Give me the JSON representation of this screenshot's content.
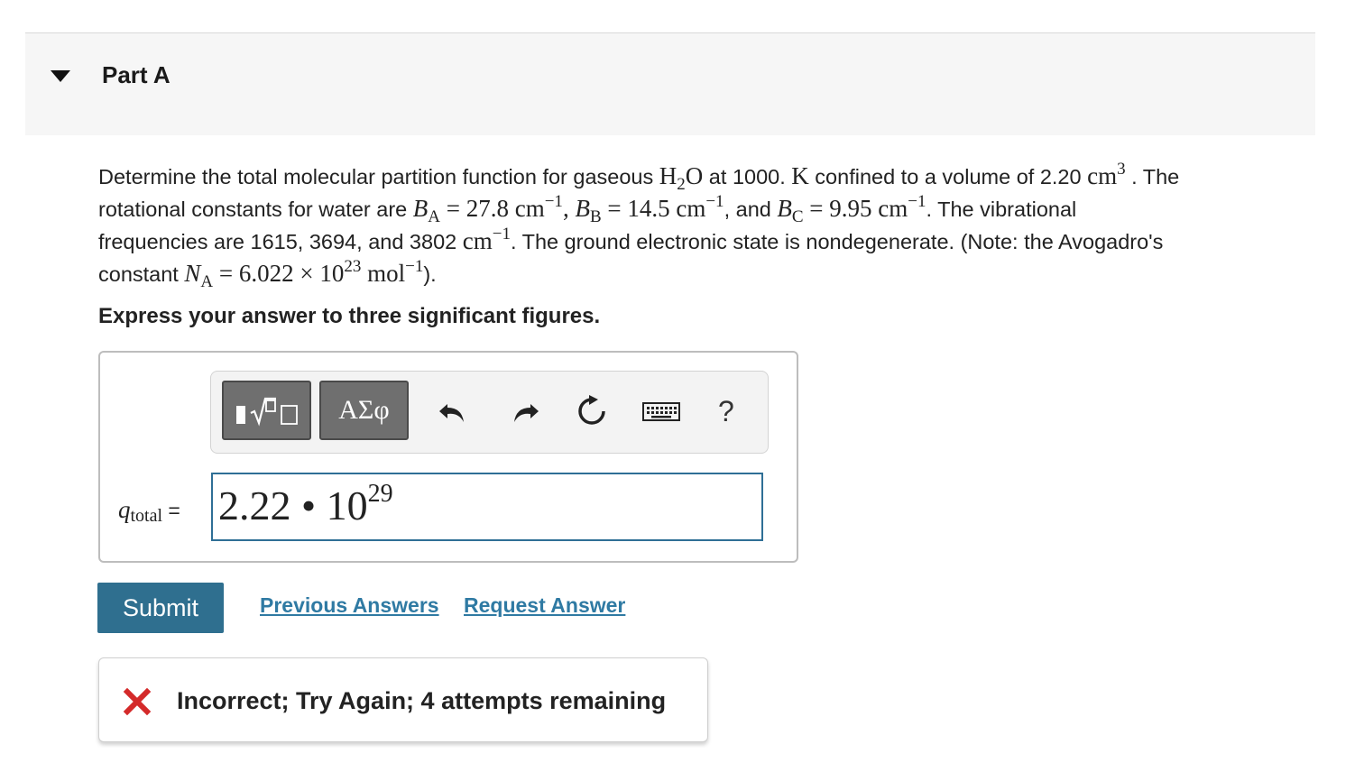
{
  "part": {
    "title": "Part A"
  },
  "question": {
    "line1": {
      "t1": "Determine the total molecular partition function for gaseous ",
      "h": "H",
      "h_sub": "2",
      "o": "O",
      "t2": " at 1000. ",
      "k": "K",
      "t3": " confined to a volume of 2.20 ",
      "cm": "cm",
      "cm_exp": "3",
      "t4": " . The"
    },
    "line2": {
      "t1": "rotational constants for water are ",
      "ba": "B",
      "ba_sub": "A",
      "ba_val": " = 27.8 cm",
      "exp1": "−1",
      "comma1": ", ",
      "bb": "B",
      "bb_sub": "B",
      "bb_val": " = 14.5 cm",
      "exp2": "−1",
      "t2": ", and ",
      "bc": "B",
      "bc_sub": "C",
      "bc_val": " = 9.95 cm",
      "exp3": "−1",
      "t3": ". The vibrational"
    },
    "line3": {
      "t1": "frequencies are 1615, 3694, and 3802 ",
      "cm": "cm",
      "exp": "−1",
      "t2": ". The ground electronic state is nondegenerate. (Note: the Avogadro's"
    },
    "line4": {
      "t1": "constant ",
      "na": "N",
      "na_sub": "A",
      "val": " = 6.022 × 10",
      "exp": "23",
      "mol": " mol",
      "mol_exp": "−1",
      "t2": ")."
    }
  },
  "instruction": "Express your answer to three significant figures.",
  "toolbar": {
    "greek_label": "ΑΣφ",
    "help_label": "?",
    "icons": [
      "templates-icon",
      "undo-icon",
      "redo-icon",
      "reset-icon",
      "keyboard-icon",
      "help-icon"
    ]
  },
  "answer": {
    "var_symbol": "q",
    "var_sub": "total",
    "equals": " =",
    "mantissa": "2.22 • 10",
    "exponent": "29"
  },
  "actions": {
    "submit_label": "Submit",
    "previous_answers_label": "Previous Answers",
    "request_answer_label": "Request Answer"
  },
  "feedback": {
    "message": "Incorrect; Try Again; 4 attempts remaining",
    "color": "#d42a2a"
  },
  "colors": {
    "accent": "#2f6f8f",
    "link": "#2f7aa3",
    "input_border": "#2f6f96"
  }
}
